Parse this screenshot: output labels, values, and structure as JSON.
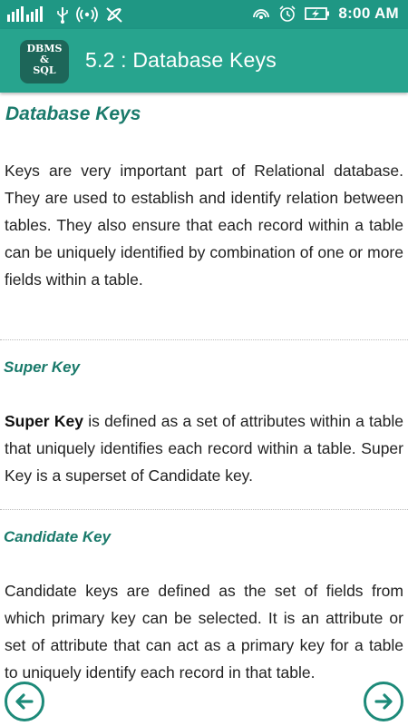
{
  "status_bar": {
    "time": "8:00 AM"
  },
  "app_bar": {
    "logo_line1": "DBMS",
    "logo_line2": "&",
    "logo_line3": "SQL",
    "title": "5.2 : Database Keys"
  },
  "content": {
    "heading": "Database Keys",
    "intro": "Keys are very important part of Relational database. They are used to establish and identify relation between tables. They also ensure that each record within a table can be uniquely identified by combination of one or more fields within a table.",
    "super_key": {
      "heading": "Super Key",
      "term": "Super Key",
      "text": " is defined as a set of attributes within a table that uniquely identifies each record within a table. Super Key is a superset of Candidate key."
    },
    "candidate_key": {
      "heading": "Candidate Key",
      "text": "Candidate keys are defined as the set of fields from which primary key can be selected. It is an attribute or set of attribute that can act as a primary key for a table to uniquely identify each record in that table."
    }
  },
  "colors": {
    "status_bar": "#1f9784",
    "app_bar": "#27a48e",
    "logo_bg": "#1d6659",
    "heading": "#1a7a6b",
    "nav_button": "#1d8a79"
  },
  "icons": [
    "signal-icon",
    "usb-icon",
    "hotspot-icon",
    "no-sim-icon",
    "cast-icon",
    "alarm-icon",
    "battery-charging-icon",
    "back-arrow-icon",
    "forward-arrow-icon"
  ]
}
